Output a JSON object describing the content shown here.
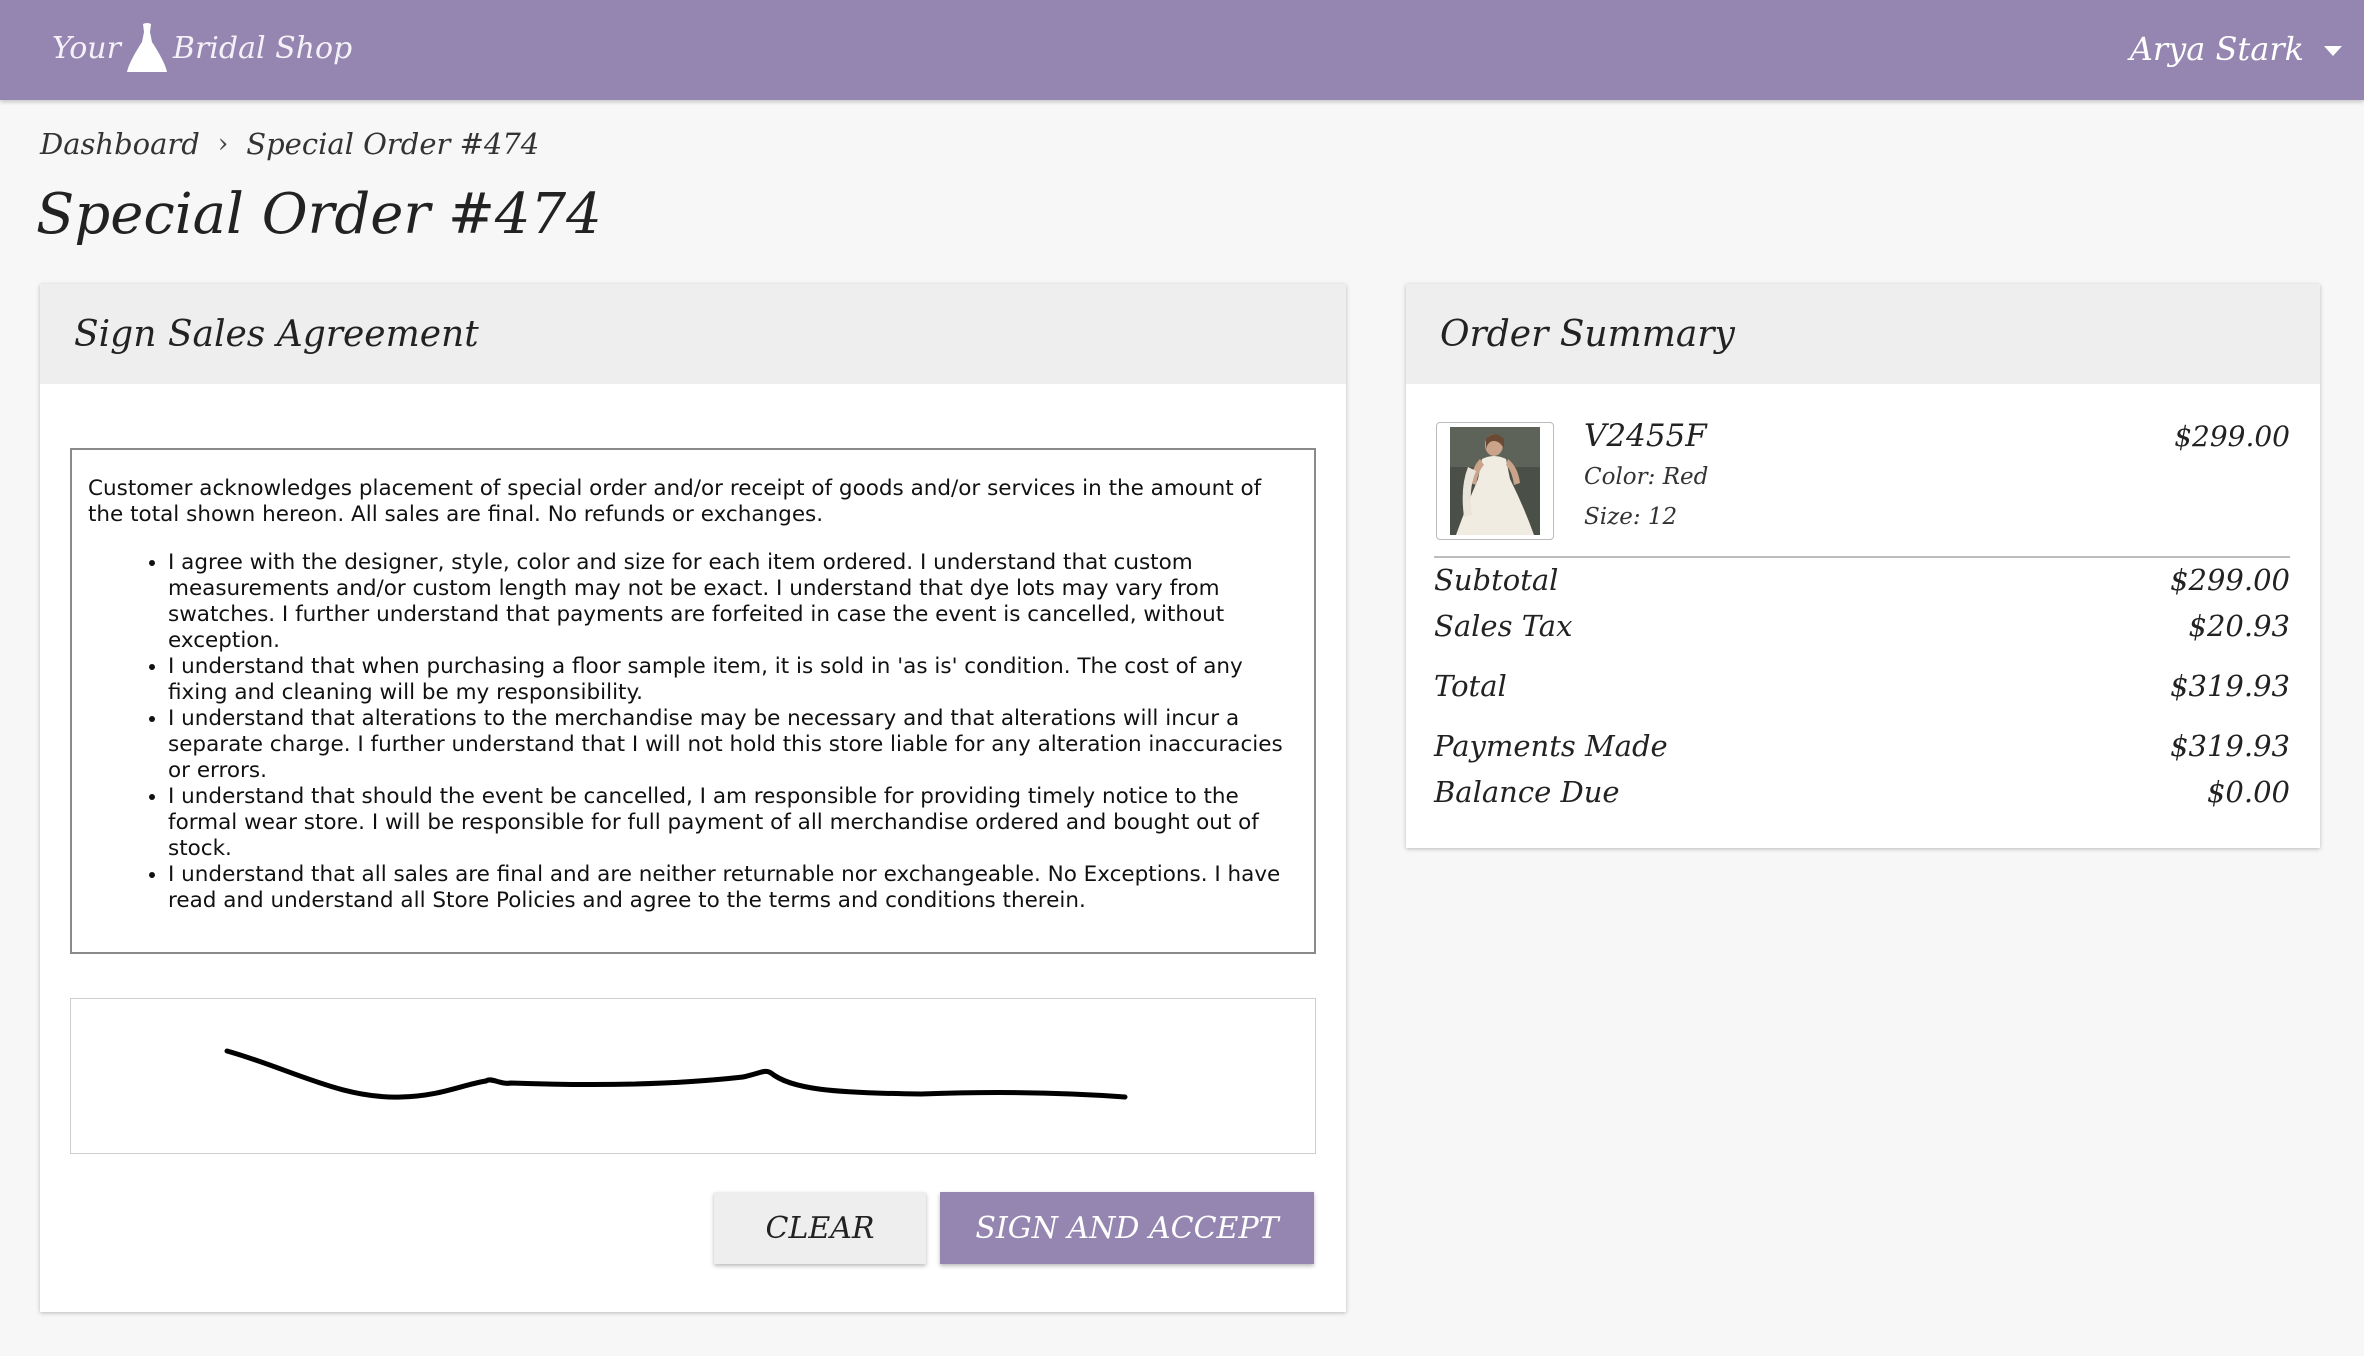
{
  "header": {
    "logo": {
      "word1": "Your",
      "word2": "Bridal Shop"
    },
    "user_name": "Arya Stark",
    "colors": {
      "accent": "#9486b0"
    }
  },
  "breadcrumb": {
    "items": [
      "Dashboard",
      "Special Order #474"
    ],
    "separator": "›"
  },
  "page_title": "Special Order #474",
  "agreement": {
    "title": "Sign Sales Agreement",
    "intro": "Customer acknowledges placement of special order and/or receipt of goods and/or services in the amount of the total shown hereon. All sales are final. No refunds or exchanges.",
    "terms": [
      "I agree with the designer, style, color and size for each item ordered. I understand that custom measurements and/or custom length may not be exact. I understand that dye lots may vary from swatches.  I further understand that payments are forfeited in case the event is cancelled, without exception.",
      "I understand that when purchasing a floor sample item, it is sold in 'as is' condition. The cost of any fixing and cleaning will be my responsibility.",
      "I understand that alterations to the merchandise may be necessary and that alterations will incur a separate charge.  I further understand that I will not hold this store liable for any alteration inaccuracies or errors.",
      "I understand that should the event be cancelled, I am responsible for providing timely notice to the formal wear store. I will be responsible for full payment of all merchandise ordered and bought out of stock.",
      "I understand that all sales are final and are neither returnable nor exchangeable.  No Exceptions. I have read and understand all Store Policies and agree to the terms and conditions therein."
    ],
    "buttons": {
      "clear": "CLEAR",
      "sign": "SIGN AND ACCEPT"
    }
  },
  "summary": {
    "title": "Order Summary",
    "item": {
      "sku": "V2455F",
      "color": "Color: Red",
      "size": "Size: 12",
      "price": "$299.00",
      "image_icon": "dress-photo-icon"
    },
    "rows": [
      {
        "label": "Subtotal",
        "value": "$299.00"
      },
      {
        "label": "Sales Tax",
        "value": "$20.93"
      },
      {
        "label": "Total",
        "value": "$319.93"
      },
      {
        "label": "Payments Made",
        "value": "$319.93"
      },
      {
        "label": "Balance Due",
        "value": "$0.00"
      }
    ]
  }
}
